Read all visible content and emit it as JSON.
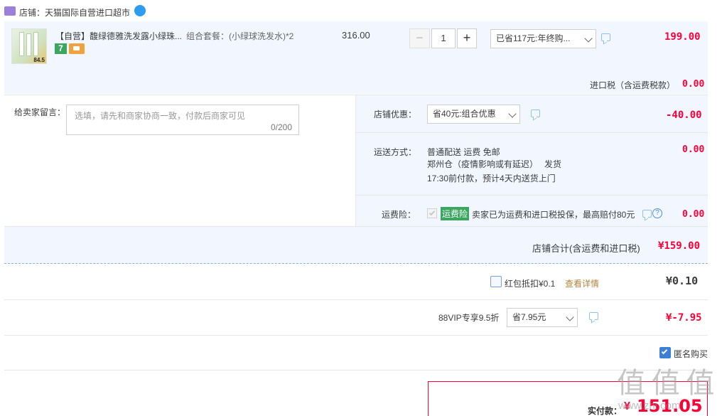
{
  "shop": {
    "label": "店铺：天猫国际自营进口超市"
  },
  "item": {
    "title": "【自营】馥绿德雅洗发露小绿珠...",
    "option": "组合套餐：(小绿球洗发水)*2",
    "unit_price": "316.00",
    "quantity": "1",
    "promo_select": "已省117元:年终购...",
    "total": "199.00",
    "thumb_badge": "84.5",
    "tag_icon": "7"
  },
  "import_tax": {
    "label": "进口税（含运费税款）",
    "value": "0.00"
  },
  "message": {
    "label": "给卖家留言：",
    "placeholder": "选填，请先和商家协商一致，付款后商家可见",
    "counter": "0/200"
  },
  "shop_discount": {
    "label": "店铺优惠：",
    "select": "省40元:组合优惠",
    "value": "-40.00"
  },
  "shipping": {
    "label": "运送方式：",
    "line1": "普通配送 运费 免邮",
    "line2a": "郑州仓（疫情影响或有延迟）",
    "line2b": "发货",
    "line3": "17:30前付款，预计4天内送货上门",
    "value": "0.00"
  },
  "insurance": {
    "label": "运费险：",
    "tag": "运费险",
    "text": "卖家已为运费和进口税投保，最高赔付80元",
    "value": "0.00"
  },
  "shop_total": {
    "label": "店铺合计(含运费和进口税)",
    "value": "¥159.00"
  },
  "red_packet": {
    "label": "红包抵扣¥0.1",
    "link": "查看详情",
    "value": "¥0.10"
  },
  "vip": {
    "label": "88VIP专享9.5折",
    "select": "省7.95元",
    "value": "¥-7.95"
  },
  "anonymous": {
    "label": "匿名购买"
  },
  "payment": {
    "label": "实付款：",
    "currency": "¥",
    "value": "151.05"
  },
  "watermark": {
    "text": "值 值 值",
    "url": "www.zhi.com"
  },
  "colors": {
    "accent_red": "#ff0036",
    "section_bg": "#f2f7ff",
    "link_orange": "#b0853c",
    "tag_green": "#3aa65f"
  }
}
